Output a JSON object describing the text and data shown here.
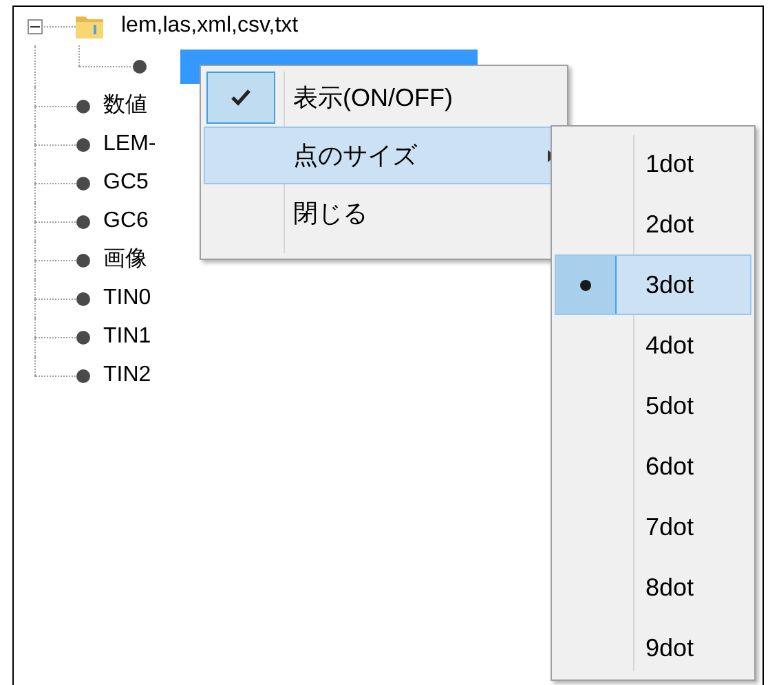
{
  "tree": [
    {
      "label": "lem,las,xml,csv,txt",
      "expanded": true,
      "selected": false,
      "children": [
        {
          "selected": true
        }
      ]
    },
    {
      "label": "数値",
      "selected": false
    },
    {
      "label": "LEM-",
      "selected": false
    },
    {
      "label": "GC5",
      "selected": false
    },
    {
      "label": "GC6",
      "selected": false
    },
    {
      "label": "画像",
      "selected": false
    },
    {
      "label": "TIN0",
      "selected": false
    },
    {
      "label": "TIN1",
      "selected": false
    },
    {
      "label": "TIN2",
      "selected": false
    }
  ],
  "context_menu": {
    "items": [
      {
        "label": "表示(ON/OFF)",
        "checked": true,
        "selected": false,
        "submenu": false
      },
      {
        "label": "点のサイズ",
        "checked": false,
        "selected": true,
        "submenu": true
      },
      {
        "label": "閉じる",
        "checked": false,
        "selected": false,
        "submenu": false
      }
    ]
  },
  "submenu": {
    "items": [
      {
        "label": "1dot",
        "checked": false,
        "selected": false
      },
      {
        "label": "2dot",
        "checked": false,
        "selected": false
      },
      {
        "label": "3dot",
        "checked": true,
        "selected": true
      },
      {
        "label": "4dot",
        "checked": false,
        "selected": false
      },
      {
        "label": "5dot",
        "checked": false,
        "selected": false
      },
      {
        "label": "6dot",
        "checked": false,
        "selected": false
      },
      {
        "label": "7dot",
        "checked": false,
        "selected": false
      },
      {
        "label": "8dot",
        "checked": false,
        "selected": false
      },
      {
        "label": "9dot",
        "checked": false,
        "selected": false
      }
    ]
  }
}
